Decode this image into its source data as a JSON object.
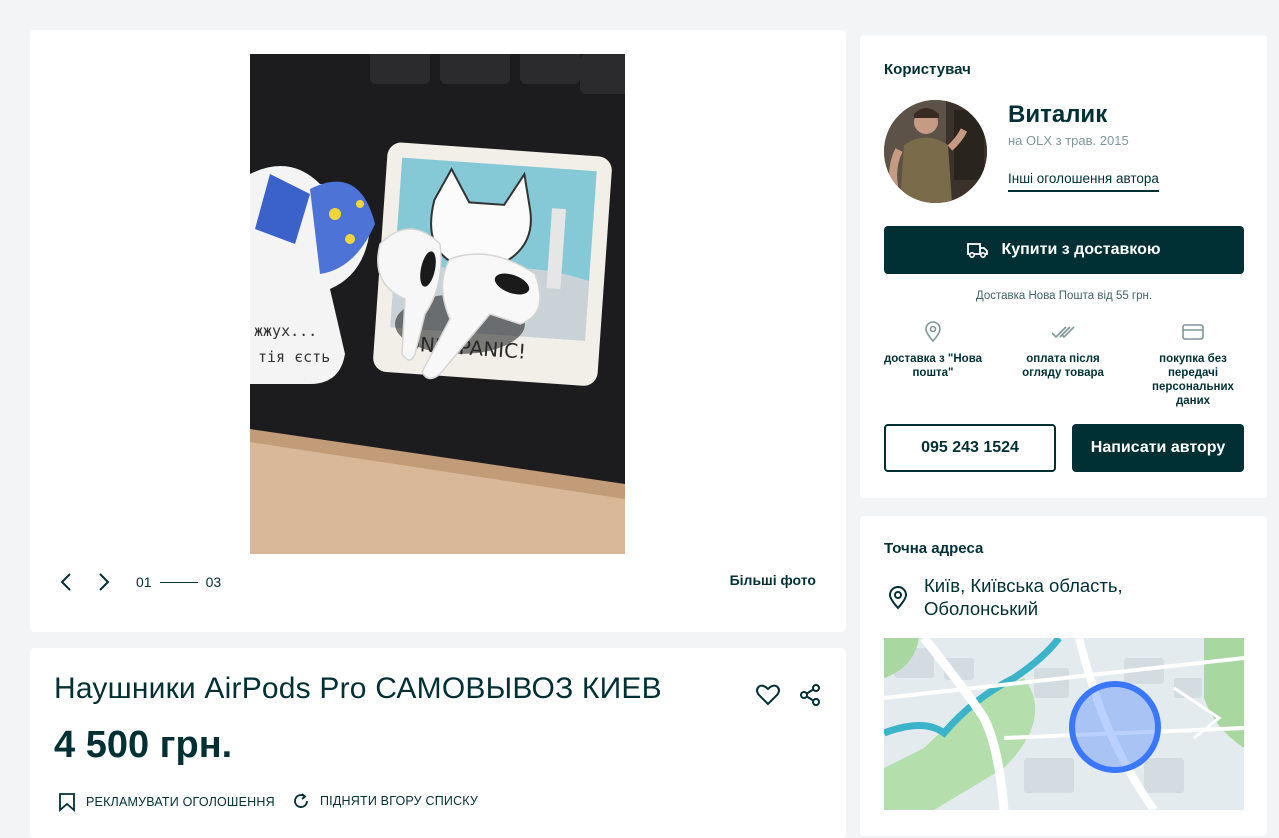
{
  "gallery": {
    "counter_current": "01",
    "counter_total": "03",
    "more_photos": "Більші фото",
    "sticker_text_1": "жжух...",
    "sticker_text_2": "тія єсть",
    "sticker_text_3": "ON'T PANIC!"
  },
  "ad": {
    "title": "Наушники AirPods Pro САМОВЫВОЗ КИЕВ",
    "price": "4 500 грн.",
    "promote_label": "РЕКЛАМУВАТИ ОГОЛОШЕННЯ",
    "raise_label": "ПІДНЯТИ ВГОРУ СПИСКУ"
  },
  "user": {
    "heading": "Користувач",
    "name": "Виталик",
    "since": "на OLX з трав. 2015",
    "other_ads": "Інші оголошення автора",
    "buy_button": "Купити з доставкою",
    "delivery_note": "Доставка Нова Пошта від 55 грн.",
    "features": [
      {
        "icon": "location-pin-icon",
        "text": "доставка з \"Нова пошта\""
      },
      {
        "icon": "double-check-icon",
        "text": "оплата після огляду товара"
      },
      {
        "icon": "card-icon",
        "text": "покупка без передачі персональних даних"
      }
    ],
    "phone": "095 243 1524",
    "write_button": "Написати автору"
  },
  "address": {
    "heading": "Точна адреса",
    "line": "Київ, Київська область, Оболонський"
  },
  "colors": {
    "primary": "#002f34",
    "background": "#f2f4f5",
    "map_circle": "#3a77ff",
    "map_green": "#a8d8a0",
    "map_water": "#3bb4c9"
  }
}
